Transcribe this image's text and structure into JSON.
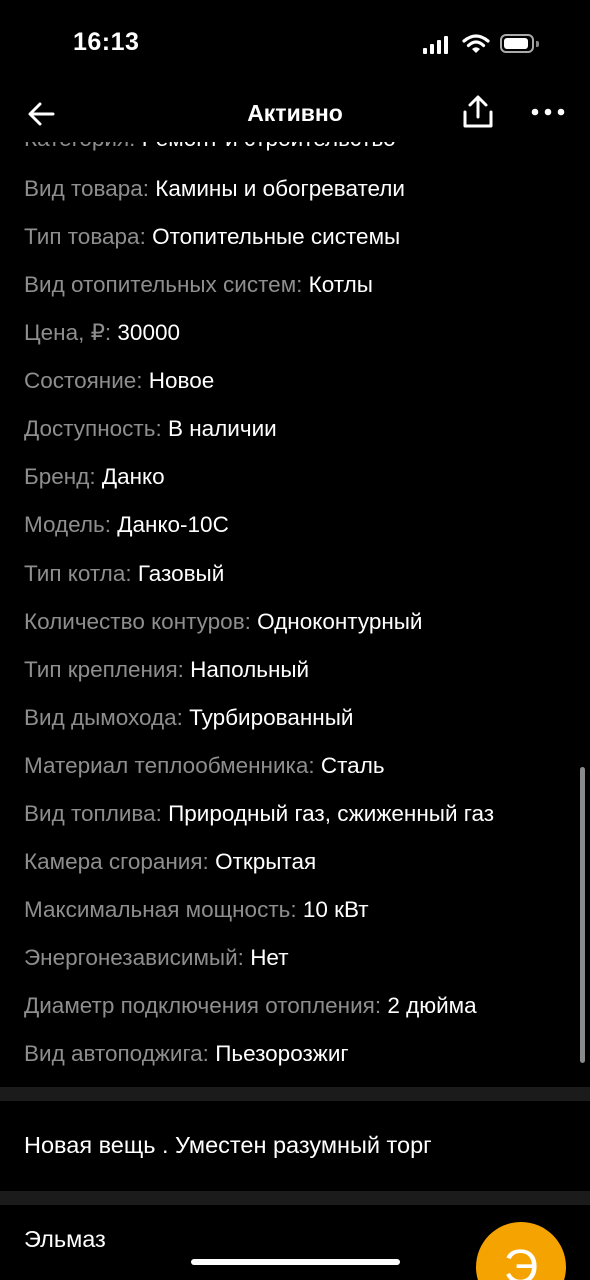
{
  "status_bar": {
    "time": "16:13"
  },
  "nav": {
    "title": "Активно"
  },
  "params": [
    {
      "label": "Категория: ",
      "value": "Ремонт и строительство"
    },
    {
      "label": "Вид товара: ",
      "value": "Камины и обогреватели"
    },
    {
      "label": "Тип товара: ",
      "value": "Отопительные системы"
    },
    {
      "label": "Вид отопительных систем: ",
      "value": "Котлы"
    },
    {
      "label": "Цена, ₽: ",
      "value": "30000"
    },
    {
      "label": "Состояние: ",
      "value": "Новое"
    },
    {
      "label": "Доступность: ",
      "value": "В наличии"
    },
    {
      "label": "Бренд: ",
      "value": "Данко"
    },
    {
      "label": "Модель: ",
      "value": "Данко-10С"
    },
    {
      "label": "Тип котла: ",
      "value": "Газовый"
    },
    {
      "label": "Количество контуров: ",
      "value": "Одноконтурный"
    },
    {
      "label": "Тип крепления: ",
      "value": "Напольный"
    },
    {
      "label": "Вид дымохода: ",
      "value": "Турбированный"
    },
    {
      "label": "Материал теплообменника: ",
      "value": "Сталь"
    },
    {
      "label": "Вид топлива: ",
      "value": "Природный газ, сжиженный газ"
    },
    {
      "label": "Камера сгорания: ",
      "value": "Открытая"
    },
    {
      "label": "Максимальная мощность: ",
      "value": "10 кВт"
    },
    {
      "label": "Энергонезависимый: ",
      "value": "Нет"
    },
    {
      "label": "Диаметр подключения отопления: ",
      "value": "2 дюйма"
    },
    {
      "label": "Вид автоподжига: ",
      "value": "Пьезорозжиг"
    }
  ],
  "description": "Новая вещь . Уместен разумный торг",
  "seller": {
    "name": "Эльмаз",
    "avatar_letter": "Э",
    "avatar_color": "#f5a300"
  },
  "icons": {
    "back": "arrow-left-icon",
    "share": "share-icon",
    "more": "more-horizontal-icon",
    "signal": "cellular-signal-icon",
    "wifi": "wifi-icon",
    "battery": "battery-icon"
  }
}
